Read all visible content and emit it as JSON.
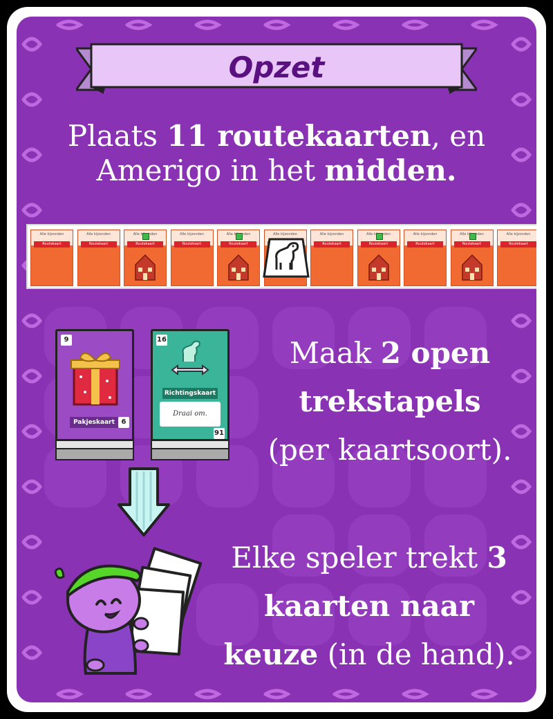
{
  "title": "Opzet",
  "step1": {
    "parts": [
      {
        "text": "Plaats ",
        "bold": false
      },
      {
        "text": "11 routekaarten",
        "bold": true
      },
      {
        "text": ", en",
        "bold": false
      }
    ],
    "line2": [
      {
        "text": "Amerigo in het ",
        "bold": false
      },
      {
        "text": "midden.",
        "bold": true
      }
    ]
  },
  "route_cards": {
    "count": 11,
    "header": "Alle kijzonden",
    "ribbon": "Routekaart",
    "houses": [
      false,
      false,
      true,
      false,
      true,
      false,
      false,
      true,
      false,
      true,
      false
    ],
    "gifts": [
      false,
      false,
      true,
      false,
      true,
      false,
      false,
      true,
      false,
      true,
      false
    ]
  },
  "step2": {
    "line1": [
      {
        "text": "Maak ",
        "bold": false
      },
      {
        "text": "2 open",
        "bold": true
      }
    ],
    "line2": [
      {
        "text": "trekstapels",
        "bold": true
      }
    ],
    "line3": [
      {
        "text": "(per kaartsoort).",
        "bold": false
      }
    ]
  },
  "pakjes_card": {
    "number_top": "9",
    "label": "Pakjeskaart",
    "number_bottom": "6"
  },
  "richting_card": {
    "number_top": "16",
    "label": "Richtingskaart",
    "text": "Draai om.",
    "number_bottom": "91"
  },
  "step3": {
    "line1": [
      {
        "text": "Elke speler trekt ",
        "bold": false
      },
      {
        "text": "3",
        "bold": true
      }
    ],
    "line2": [
      {
        "text": "kaarten naar",
        "bold": true
      }
    ],
    "line3": [
      {
        "text": "keuze",
        "bold": true
      },
      {
        "text": " (in de hand).",
        "bold": false
      }
    ]
  },
  "colors": {
    "background": "#8a32b4",
    "banner": "#e3bdf5",
    "route_card": "#f06a32",
    "richting_card": "#3bb59a",
    "arrow": "#c8f4f2"
  },
  "icons": [
    "gift-icon",
    "horse-icon",
    "down-arrow-icon",
    "piet-character-icon",
    "house-icon"
  ]
}
